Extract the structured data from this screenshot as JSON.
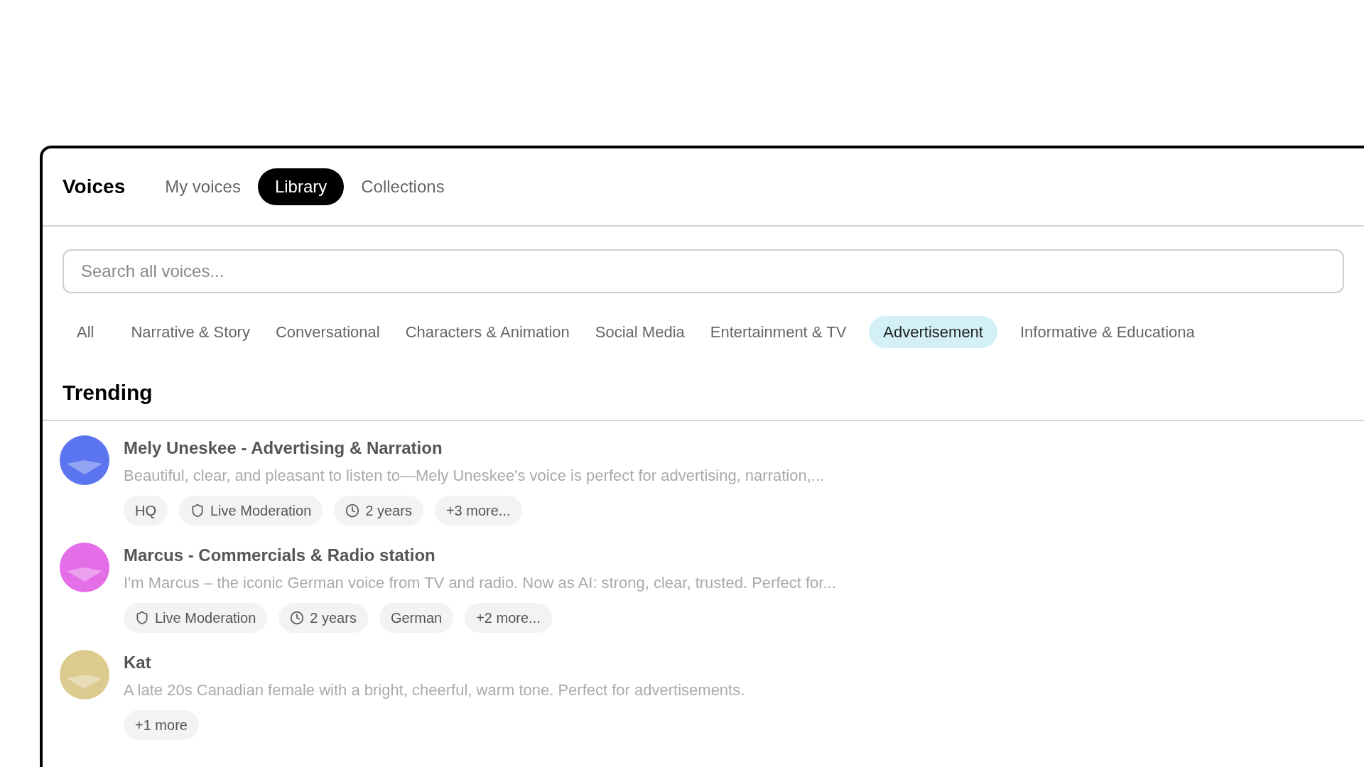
{
  "header": {
    "title": "Voices",
    "tabs": [
      {
        "label": "My voices",
        "selected": false
      },
      {
        "label": "Library",
        "selected": true
      },
      {
        "label": "Collections",
        "selected": false
      }
    ]
  },
  "search": {
    "placeholder": "Search all voices..."
  },
  "categories": [
    {
      "label": "All",
      "selected": false
    },
    {
      "label": "Narrative & Story",
      "selected": false
    },
    {
      "label": "Conversational",
      "selected": false
    },
    {
      "label": "Characters & Animation",
      "selected": false
    },
    {
      "label": "Social Media",
      "selected": false
    },
    {
      "label": "Entertainment & TV",
      "selected": false
    },
    {
      "label": "Advertisement",
      "selected": true
    },
    {
      "label": "Informative & Educationa",
      "selected": false
    }
  ],
  "section_title": "Trending",
  "voices": [
    {
      "name": "Mely Uneskee - Advertising & Narration",
      "description": "Beautiful, clear, and pleasant to listen to—Mely Uneskee's voice is perfect for advertising, narration,...",
      "color": "#5b74f0",
      "tags": [
        {
          "kind": "plain",
          "label": "HQ"
        },
        {
          "kind": "shield",
          "label": "Live Moderation"
        },
        {
          "kind": "clock",
          "label": "2 years"
        },
        {
          "kind": "plain",
          "label": "+3 more..."
        }
      ]
    },
    {
      "name": "Marcus - Commercials & Radio station",
      "description": "I'm Marcus – the iconic German voice from TV and radio. Now as AI: strong, clear, trusted. Perfect for...",
      "color": "#e46de8",
      "tags": [
        {
          "kind": "shield",
          "label": "Live Moderation"
        },
        {
          "kind": "clock",
          "label": "2 years"
        },
        {
          "kind": "plain",
          "label": "German"
        },
        {
          "kind": "plain",
          "label": "+2 more..."
        }
      ]
    },
    {
      "name": "Kat",
      "description": "A late 20s Canadian female with a bright, cheerful, warm tone. Perfect for advertisements.",
      "color": "#dccb8f",
      "tags": [
        {
          "kind": "plain",
          "label": "+1 more"
        }
      ]
    }
  ]
}
